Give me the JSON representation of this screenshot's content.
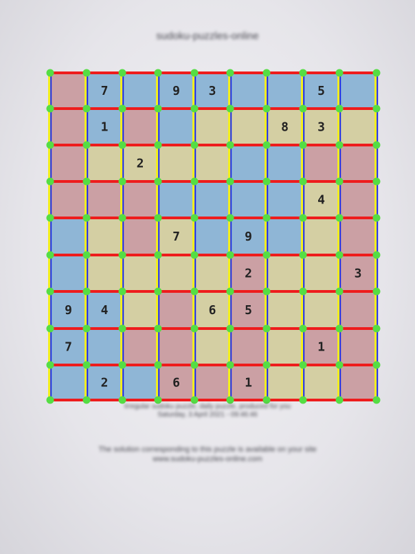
{
  "document": {
    "title": "sudoku-puzzles-online",
    "footer_line1": "Irregular sudoku puzzle, daily puzzle, produced for you",
    "footer_line2": "Saturday, 3 April 2021 - 09:46:46",
    "footer_line3": "The solution corresponding to this puzzle is available on your site",
    "footer_line4": "www.sudoku-puzzles-online.com"
  },
  "colors": {
    "B": "#8fb6d6",
    "Y": "#d4cfa3",
    "R": "#cba0a4",
    "h_line": "#ee1c1c",
    "v_line_yellow": "#f2ee1e",
    "v_line_blue": "#1a2ae0",
    "node": "#55dd44"
  },
  "grid": {
    "regions": [
      [
        "R",
        "B",
        "B",
        "B",
        "B",
        "B",
        "B",
        "B",
        "B"
      ],
      [
        "R",
        "B",
        "R",
        "B",
        "Y",
        "Y",
        "Y",
        "Y",
        "Y"
      ],
      [
        "R",
        "Y",
        "Y",
        "Y",
        "Y",
        "B",
        "B",
        "R",
        "R"
      ],
      [
        "R",
        "R",
        "R",
        "B",
        "B",
        "B",
        "B",
        "Y",
        "R"
      ],
      [
        "B",
        "Y",
        "R",
        "Y",
        "B",
        "B",
        "B",
        "Y",
        "R"
      ],
      [
        "B",
        "Y",
        "Y",
        "Y",
        "Y",
        "R",
        "Y",
        "Y",
        "R"
      ],
      [
        "B",
        "B",
        "Y",
        "R",
        "Y",
        "R",
        "Y",
        "Y",
        "R"
      ],
      [
        "B",
        "B",
        "R",
        "R",
        "Y",
        "R",
        "Y",
        "R",
        "R"
      ],
      [
        "B",
        "B",
        "B",
        "R",
        "R",
        "R",
        "Y",
        "Y",
        "R"
      ]
    ],
    "digits": [
      [
        "",
        "7",
        "",
        "9",
        "3",
        "",
        "",
        "5",
        ""
      ],
      [
        "",
        "1",
        "",
        "",
        "",
        "",
        "8",
        "3",
        ""
      ],
      [
        "",
        "",
        "2",
        "",
        "",
        "",
        "",
        "",
        ""
      ],
      [
        "",
        "",
        "",
        "",
        "",
        "",
        "",
        "4",
        ""
      ],
      [
        "",
        "",
        "",
        "7",
        "",
        "9",
        "",
        "",
        ""
      ],
      [
        "",
        "",
        "",
        "",
        "",
        "2",
        "",
        "",
        "3"
      ],
      [
        "9",
        "4",
        "",
        "",
        "6",
        "5",
        "",
        "",
        ""
      ],
      [
        "7",
        "",
        "",
        "",
        "",
        "",
        "",
        "1",
        ""
      ],
      [
        "",
        "2",
        "",
        "6",
        "",
        "1",
        "",
        "",
        ""
      ]
    ]
  }
}
